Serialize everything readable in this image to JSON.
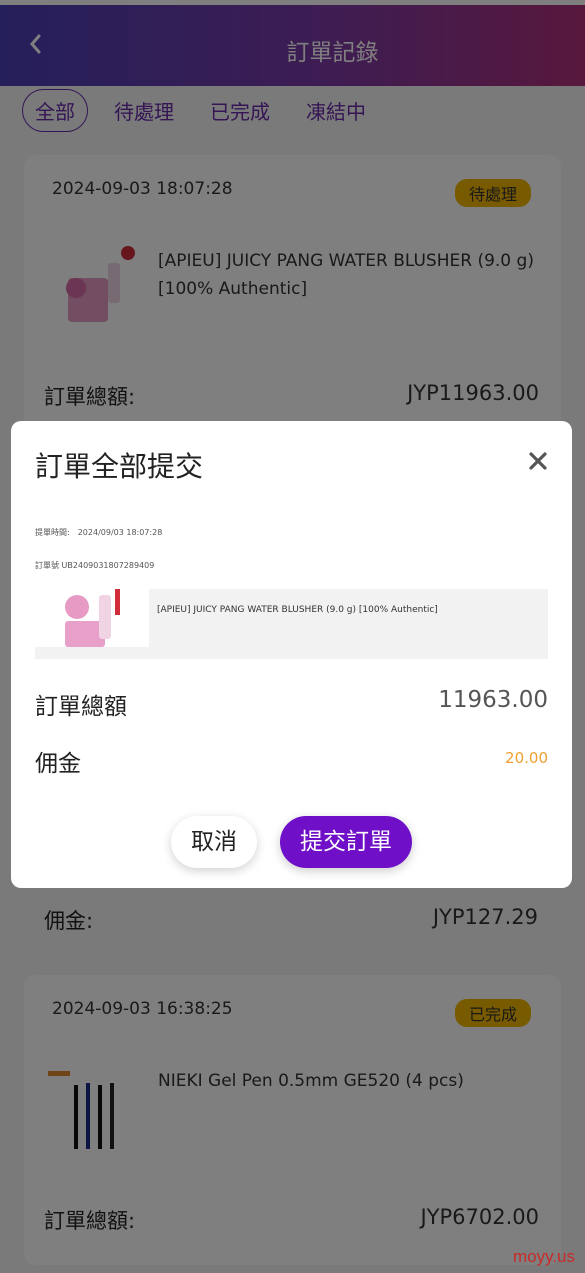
{
  "header": {
    "title": "訂單記錄"
  },
  "tabs": [
    {
      "label": "全部",
      "active": true
    },
    {
      "label": "待處理",
      "active": false
    },
    {
      "label": "已完成",
      "active": false
    },
    {
      "label": "凍結中",
      "active": false
    }
  ],
  "orders": [
    {
      "datetime": "2024-09-03 18:07:28",
      "status": "待處理",
      "product_name": "[APIEU] JUICY PANG WATER BLUSHER (9.0 g) [100% Authentic]",
      "total_label": "訂單總額:",
      "total_value": "JYP11963.00"
    },
    {
      "commission_label": "佣金:",
      "commission_value": "JYP127.29"
    },
    {
      "datetime": "2024-09-03 16:38:25",
      "status": "已完成",
      "product_name": "NIEKI Gel Pen 0.5mm GE520 (4 pcs)",
      "total_label": "訂單總額:",
      "total_value": "JYP6702.00"
    }
  ],
  "modal": {
    "title": "訂單全部提交",
    "submit_time_label": "提單時間:",
    "submit_time_value": "2024/09/03 18:07:28",
    "order_no_label": "訂單號",
    "order_no_value": "UB2409031807289409",
    "product_name": "[APIEU] JUICY PANG WATER BLUSHER (9.0 g) [100% Authentic]",
    "total_label": "訂單總額",
    "total_value": "11963.00",
    "commission_label": "佣金",
    "commission_value": "20.00",
    "cancel_label": "取消",
    "submit_label": "提交訂單"
  },
  "watermark": "moyy.us",
  "colors": {
    "accent": "#6f10c8",
    "badge": "#f0b400",
    "commission": "#f0a030"
  }
}
